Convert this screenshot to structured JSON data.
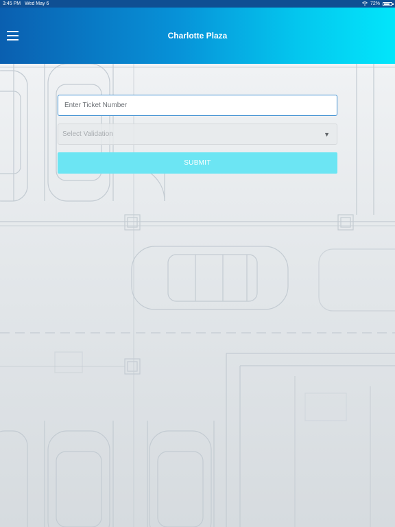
{
  "status_bar": {
    "time": "3:45 PM",
    "date": "Wed May 6",
    "battery": "72%"
  },
  "header": {
    "title": "Charlotte Plaza"
  },
  "form": {
    "ticket_placeholder": "Enter Ticket Number",
    "ticket_value": "",
    "validation_placeholder": "Select Validation",
    "submit_label": "SUBMIT"
  },
  "icons": {
    "menu": "hamburger-menu-icon",
    "dropdown": "caret-down-icon",
    "wifi": "wifi-icon",
    "battery": "battery-icon"
  },
  "colors": {
    "header_start": "#0a5fb0",
    "header_end": "#02e6fb",
    "input_border": "#3d8fd1",
    "submit_bg": "#6ce5f3",
    "status_bar": "#0f4f93"
  }
}
